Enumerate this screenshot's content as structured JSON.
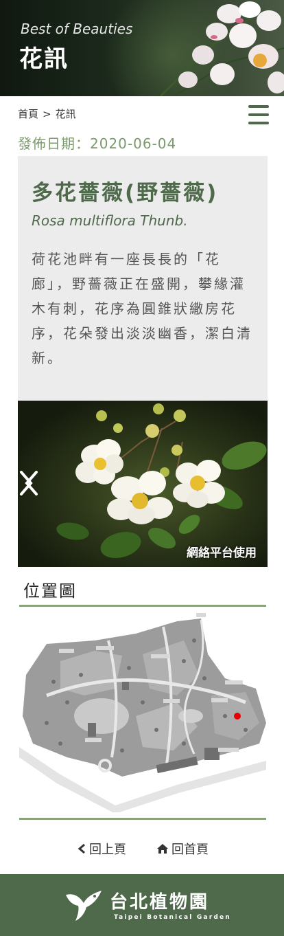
{
  "header": {
    "subtitle": "Best of Beauties",
    "title": "花訊"
  },
  "breadcrumb": {
    "home": "首頁",
    "separator": ">",
    "current": "花訊"
  },
  "post": {
    "date_label": "發佈日期：",
    "date": "2020-06-04",
    "name": "多花薔薇(野薔薇)",
    "latin": "Rosa multiflora Thunb.",
    "description": "荷花池畔有一座長長的「花廊」，野薔薇正在盛開，攀緣灌木有刺，花序為圓錐狀繖房花序，花朵發出淡淡幽香，潔白清新。"
  },
  "slider": {
    "credit": "網絡平台使用"
  },
  "location": {
    "title": "位置圖"
  },
  "nav": {
    "back": "回上頁",
    "home": "回首頁"
  },
  "footer": {
    "logo_cn": "台北植物園",
    "logo_en": "Taipei Botanical Garden"
  },
  "colors": {
    "brand_green": "#4e6a4b",
    "date_green": "#7a9a6b",
    "marker_red": "#e60000"
  },
  "icons": [
    "hamburger-menu-icon",
    "chevron-left-icon",
    "chevron-right-icon",
    "home-icon",
    "bird-logo-icon"
  ]
}
